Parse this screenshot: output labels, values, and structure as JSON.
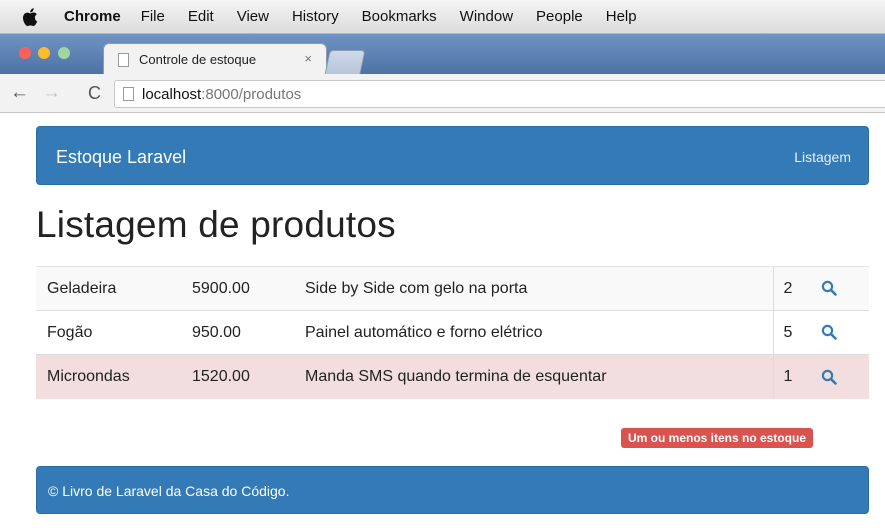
{
  "menubar": {
    "app_name": "Chrome",
    "items": [
      "File",
      "Edit",
      "View",
      "History",
      "Bookmarks",
      "Window",
      "People",
      "Help"
    ]
  },
  "browser": {
    "tab_title": "Controle de estoque",
    "tab_close": "×",
    "url_host": "localhost",
    "url_path": ":8000/produtos"
  },
  "navbar": {
    "brand": "Estoque Laravel",
    "link": "Listagem",
    "color": "#337ab7"
  },
  "main": {
    "title": "Listagem de produtos",
    "products": [
      {
        "name": "Geladeira",
        "price": "5900.00",
        "description": "Side by Side com gelo na porta",
        "quantity": "2",
        "low_stock": false
      },
      {
        "name": "Fogão",
        "price": "950.00",
        "description": "Painel automático e forno elétrico",
        "quantity": "5",
        "low_stock": false
      },
      {
        "name": "Microondas",
        "price": "1520.00",
        "description": "Manda SMS quando termina de esquentar",
        "quantity": "1",
        "low_stock": true
      }
    ],
    "legend_label": "Um ou menos itens no estoque",
    "danger_color": "#d9534f",
    "row_danger_color": "#f2dede",
    "view_icon": "search-icon"
  },
  "footer": {
    "text": "© Livro de Laravel da Casa do Código."
  }
}
